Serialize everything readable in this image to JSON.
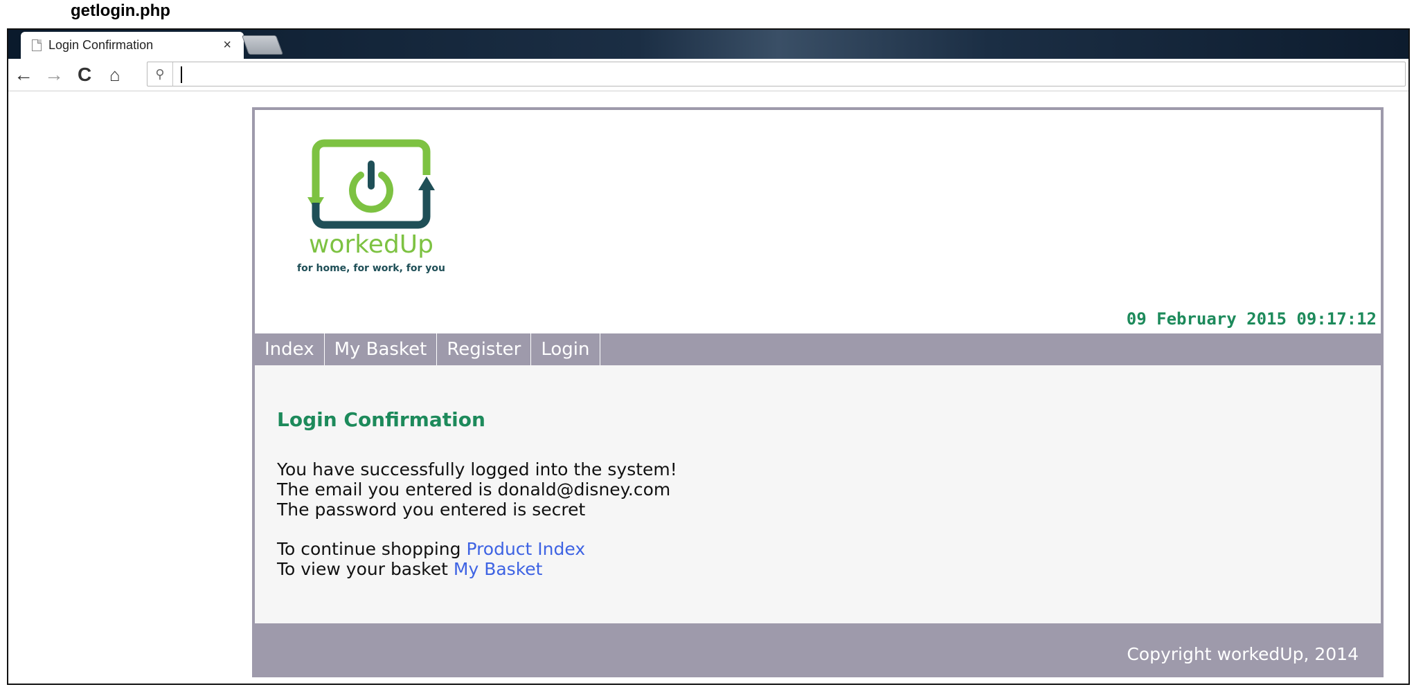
{
  "caption": "getlogin.php",
  "browser": {
    "tab_title": "Login Confirmation",
    "tab_close": "×",
    "address_value": "",
    "icons": {
      "back": "←",
      "forward": "→",
      "reload": "C",
      "home": "⌂",
      "search": "⚲"
    }
  },
  "site": {
    "logo": {
      "name": "workedUp",
      "tagline": "for home, for work, for you"
    },
    "datetime": "09 February 2015 09:17:12",
    "menu": [
      {
        "label": "Index"
      },
      {
        "label": "My Basket"
      },
      {
        "label": "Register"
      },
      {
        "label": "Login"
      }
    ],
    "content": {
      "heading": "Login Confirmation",
      "line1": "You have successfully logged into the system!",
      "line2": "The email you entered is donald@disney.com",
      "line3": "The password you entered is secret",
      "continue_text": "To continue shopping",
      "continue_link": "Product Index",
      "basket_text": "To view your basket",
      "basket_link": "My Basket"
    },
    "footer": "Copyright workedUp, 2014"
  },
  "colors": {
    "accent_green": "#1d8a5b",
    "logo_lime": "#7dc242",
    "logo_teal": "#1f4f57",
    "menu_bar": "#9e9aab",
    "link_blue": "#3e63e3"
  }
}
